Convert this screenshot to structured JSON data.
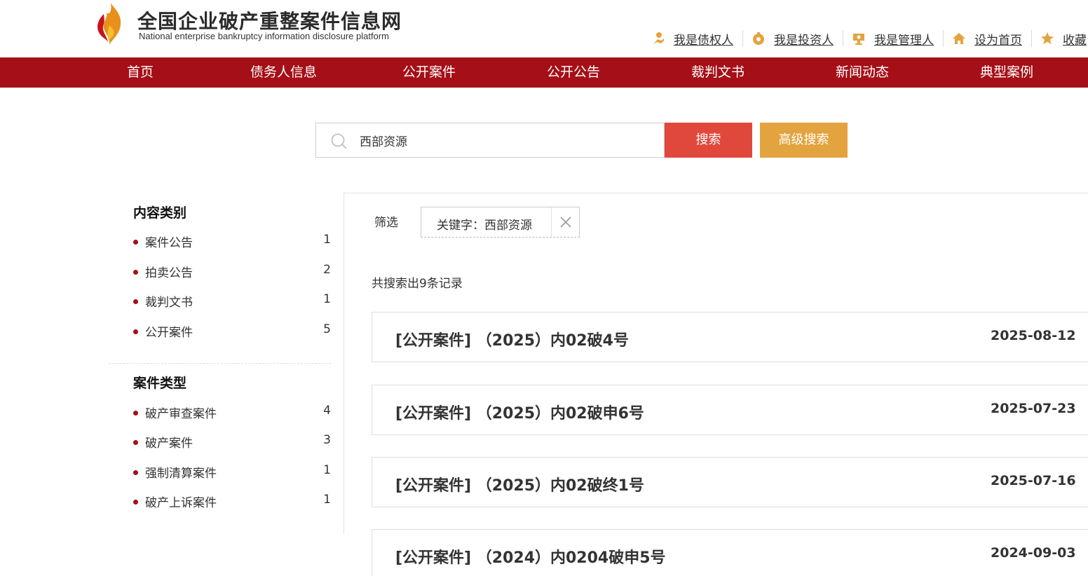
{
  "header": {
    "title": "全国企业破产重整案件信息网",
    "subtitle": "National enterprise bankruptcy  information disclosure platform",
    "links": [
      {
        "label": "我是债权人",
        "icon": "creditor-icon"
      },
      {
        "label": "我是投资人",
        "icon": "investor-icon"
      },
      {
        "label": "我是管理人",
        "icon": "manager-icon"
      },
      {
        "label": "设为首页",
        "icon": "home-icon"
      },
      {
        "label": "收藏",
        "icon": "star-icon"
      }
    ]
  },
  "nav": {
    "items": [
      "首页",
      "债务人信息",
      "公开案件",
      "公开公告",
      "裁判文书",
      "新闻动态",
      "典型案例"
    ]
  },
  "search": {
    "value": "西部资源",
    "search_label": "搜索",
    "advanced_label": "高级搜索"
  },
  "sidebar": {
    "content_heading": "内容类别",
    "content_items": [
      {
        "label": "案件公告",
        "count": "1"
      },
      {
        "label": "拍卖公告",
        "count": "2"
      },
      {
        "label": "裁判文书",
        "count": "1"
      },
      {
        "label": "公开案件",
        "count": "5"
      }
    ],
    "case_heading": "案件类型",
    "case_items": [
      {
        "label": "破产审查案件",
        "count": "4"
      },
      {
        "label": "破产案件",
        "count": "3"
      },
      {
        "label": "强制清算案件",
        "count": "1"
      },
      {
        "label": "破产上诉案件",
        "count": "1"
      }
    ]
  },
  "filter": {
    "label": "筛选",
    "tag": "关键字：西部资源"
  },
  "results": {
    "count_text": "共搜索出9条记录",
    "items": [
      {
        "title": "[公开案件] （2025）内02破4号",
        "date": "2025-08-12"
      },
      {
        "title": "[公开案件] （2025）内02破申6号",
        "date": "2025-07-23"
      },
      {
        "title": "[公开案件] （2025）内02破终1号",
        "date": "2025-07-16"
      },
      {
        "title": "[公开案件] （2024）内0204破申5号",
        "date": "2024-09-03"
      }
    ]
  },
  "colors": {
    "nav_bg": "#a50f17",
    "search_btn": "#e1483c",
    "advanced_btn": "#e3a33e",
    "bullet": "#a50f17"
  }
}
